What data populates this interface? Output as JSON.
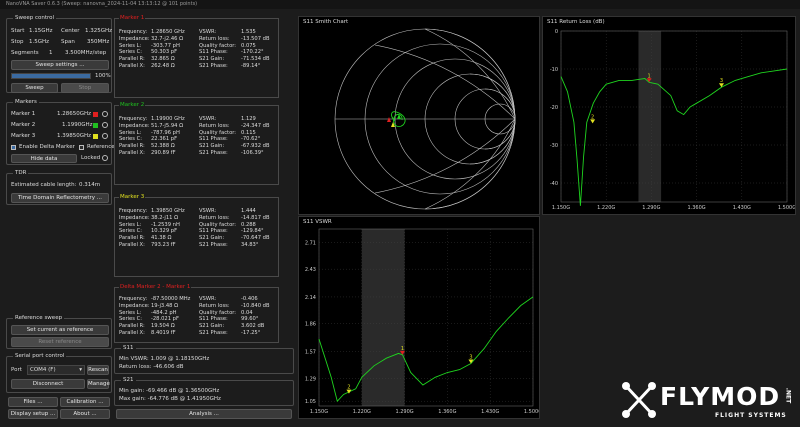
{
  "window": {
    "title": "NanoVNA Saver 0.6.3 (Sweep: nanovna_2024-11-04 13:13:12 @ 101 points)"
  },
  "sweep": {
    "title": "Sweep control",
    "start_label": "Start",
    "start_value": "1.15GHz",
    "center_label": "Center",
    "center_value": "1.325GHz",
    "stop_label": "Stop",
    "stop_value": "1.5GHz",
    "span_label": "Span",
    "span_value": "350MHz",
    "segments_label": "Segments",
    "segments_value": "1",
    "step_value": "3.500MHz/step",
    "settings_button": "Sweep settings ...",
    "progress_text": "100%",
    "progress": 1.0,
    "sweep_button": "Sweep",
    "stop_button": "Stop"
  },
  "markers": {
    "title": "Markers",
    "items": [
      {
        "label": "Marker 1",
        "value": "1.28650GHz",
        "color": "#e02020"
      },
      {
        "label": "Marker 2",
        "value": "1.1990GHz",
        "color": "#20c020"
      },
      {
        "label": "Marker 3",
        "value": "1.39850GHz",
        "color": "#e0e020"
      }
    ],
    "delta_label": "Enable Delta Marker",
    "reference_label": "Reference",
    "hide_button": "Hide data",
    "locked_label": "Locked"
  },
  "tdr": {
    "title": "TDR",
    "cable_label": "Estimated cable length:",
    "cable_value": "0.314m",
    "tdr_button": "Time Domain Reflectometry ..."
  },
  "reference_sweep": {
    "title": "Reference sweep",
    "set_button": "Set current as reference",
    "reset_button": "Reset reference"
  },
  "serial": {
    "title": "Serial port control",
    "port_label": "Port",
    "port_value": "COM4 (F)",
    "rescan_button": "Rescan",
    "disconnect_button": "Disconnect",
    "manage_button": "Manage"
  },
  "bottom_buttons": {
    "files": "Files ...",
    "calibration": "Calibration ...",
    "display": "Display setup ...",
    "about": "About ...",
    "analysis": "Analysis ..."
  },
  "marker_details": [
    {
      "title": "Marker 1",
      "left": [
        [
          "Frequency:",
          "1.28650 GHz"
        ],
        [
          "Impedance:",
          "32.7-j2.46 Ω"
        ],
        [
          "Series L:",
          "-303.77 pH"
        ],
        [
          "Series C:",
          "50.303 pF"
        ],
        [
          "Parallel R:",
          "32.865 Ω"
        ],
        [
          "Parallel X:",
          "262.48 Ω"
        ]
      ],
      "right": [
        [
          "VSWR:",
          "1.535"
        ],
        [
          "Return loss:",
          "-13.507 dB"
        ],
        [
          "Quality factor:",
          "0.075"
        ],
        [
          "S11 Phase:",
          "-170.22°"
        ],
        [
          "S21 Gain:",
          "-71.534 dB"
        ],
        [
          "S21 Phase:",
          "-89.14°"
        ]
      ]
    },
    {
      "title": "Marker 2",
      "left": [
        [
          "Frequency:",
          "1.19900 GHz"
        ],
        [
          "Impedance:",
          "51.7-j5.94 Ω"
        ],
        [
          "Series L:",
          "-787.96 pH"
        ],
        [
          "Series C:",
          "22.361 pF"
        ],
        [
          "Parallel R:",
          "52.388 Ω"
        ],
        [
          "Parallel X:",
          "290.89 fF"
        ]
      ],
      "right": [
        [
          "VSWR:",
          "1.129"
        ],
        [
          "Return loss:",
          "-24.347 dB"
        ],
        [
          "Quality factor:",
          "0.115"
        ],
        [
          "S11 Phase:",
          "-70.62°"
        ],
        [
          "S21 Gain:",
          "-67.932 dB"
        ],
        [
          "S21 Phase:",
          "-106.39°"
        ]
      ]
    },
    {
      "title": "Marker 3",
      "left": [
        [
          "Frequency:",
          "1.39850 GHz"
        ],
        [
          "Impedance:",
          "38.2-j11 Ω"
        ],
        [
          "Series L:",
          "-1.2539 nH"
        ],
        [
          "Series C:",
          "10.329 pF"
        ],
        [
          "Parallel R:",
          "41.38 Ω"
        ],
        [
          "Parallel X:",
          "793.23 fF"
        ]
      ],
      "right": [
        [
          "VSWR:",
          "1.444"
        ],
        [
          "Return loss:",
          "-14.817 dB"
        ],
        [
          "Quality factor:",
          "0.288"
        ],
        [
          "S11 Phase:",
          "-129.84°"
        ],
        [
          "S21 Gain:",
          "-70.647 dB"
        ],
        [
          "S21 Phase:",
          "34.83°"
        ]
      ]
    },
    {
      "title": "Delta Marker 2 - Marker 1",
      "left": [
        [
          "Frequency:",
          "-87.50000 MHz"
        ],
        [
          "Impedance:",
          "19-j3.48 Ω"
        ],
        [
          "Series L:",
          "-484.2 pH"
        ],
        [
          "Series C:",
          "-28.021 pF"
        ],
        [
          "Parallel R:",
          "19.504 Ω"
        ],
        [
          "Parallel X:",
          "8.4019 fF"
        ]
      ],
      "right": [
        [
          "VSWR:",
          "-0.406"
        ],
        [
          "Return loss:",
          "-10.840 dB"
        ],
        [
          "Quality factor:",
          "0.04"
        ],
        [
          "S11 Phase:",
          "99.60°"
        ],
        [
          "S21 Gain:",
          "3.602 dB"
        ],
        [
          "S21 Phase:",
          "-17.25°"
        ]
      ]
    }
  ],
  "s11_summary": {
    "title": "S11",
    "min_vswr": "Min VSWR: 1.009 @ 1.18150GHz",
    "return_loss": "Return loss: -46.606 dB"
  },
  "s21_summary": {
    "title": "S21",
    "min_gain": "Min gain: -69.466 dB @ 1.36500GHz",
    "max_gain": "Max gain: -64.776 dB @ 1.41950GHz"
  },
  "charts": {
    "smith_title": "S11 Smith Chart",
    "rl_title": "S11 Return Loss (dB)",
    "vswr_title": "S11 VSWR",
    "trace_color": "#1fd41f"
  },
  "chart_data": [
    {
      "type": "line",
      "title": "S11 Return Loss (dB)",
      "x_ticks": [
        "1.150G",
        "1.220G",
        "1.290G",
        "1.360G",
        "1.430G",
        "1.500G"
      ],
      "y_ticks": [
        "0",
        "-10",
        "-20",
        "-30",
        "-40"
      ],
      "ylim": [
        -45,
        0
      ],
      "xlim": [
        1.15,
        1.5
      ],
      "series": [
        {
          "x": [
            1.15,
            1.16,
            1.17,
            1.175,
            1.18,
            1.185,
            1.19,
            1.2,
            1.21,
            1.22,
            1.24,
            1.26,
            1.28,
            1.2865,
            1.3,
            1.32,
            1.33,
            1.34,
            1.35,
            1.36,
            1.38,
            1.3985,
            1.42,
            1.44,
            1.46,
            1.48,
            1.5
          ],
          "y": [
            -12,
            -16,
            -24,
            -34,
            -46,
            -33,
            -24,
            -19,
            -16,
            -14,
            -13,
            -13,
            -12.5,
            -13.5,
            -14,
            -17,
            -21,
            -22,
            -20,
            -19,
            -17,
            -14.8,
            -13,
            -12,
            -11,
            -10.5,
            -10
          ]
        }
      ],
      "markers": [
        {
          "label": "1",
          "x": 1.2865,
          "y": -13.5
        },
        {
          "label": "2",
          "x": 1.199,
          "y": -24.3
        },
        {
          "label": "3",
          "x": 1.3985,
          "y": -14.8
        }
      ]
    },
    {
      "type": "line",
      "title": "S11 VSWR",
      "x_ticks": [
        "1.150G",
        "1.220G",
        "1.290G",
        "1.360G",
        "1.430G",
        "1.500G"
      ],
      "y_ticks": [
        "1.05",
        "1.29",
        "1.57",
        "1.86",
        "2.14",
        "2.43",
        "2.71"
      ],
      "ylim": [
        1.0,
        2.85
      ],
      "xlim": [
        1.15,
        1.5
      ],
      "series": [
        {
          "x": [
            1.15,
            1.17,
            1.18,
            1.19,
            1.2,
            1.21,
            1.22,
            1.24,
            1.26,
            1.28,
            1.2865,
            1.3,
            1.32,
            1.34,
            1.36,
            1.38,
            1.3985,
            1.42,
            1.44,
            1.46,
            1.48,
            1.5
          ],
          "y": [
            1.7,
            1.3,
            1.05,
            1.12,
            1.15,
            1.18,
            1.3,
            1.42,
            1.5,
            1.55,
            1.535,
            1.35,
            1.22,
            1.3,
            1.35,
            1.38,
            1.444,
            1.6,
            1.78,
            1.92,
            2.05,
            2.14
          ]
        }
      ],
      "markers": [
        {
          "label": "1",
          "x": 1.2865,
          "y": 1.535
        },
        {
          "label": "2",
          "x": 1.199,
          "y": 1.129
        },
        {
          "label": "3",
          "x": 1.3985,
          "y": 1.444
        }
      ]
    }
  ],
  "logo": {
    "text": "FLYMOD",
    "sub": "FLIGHT SYSTEMS",
    "net": ".NET"
  }
}
